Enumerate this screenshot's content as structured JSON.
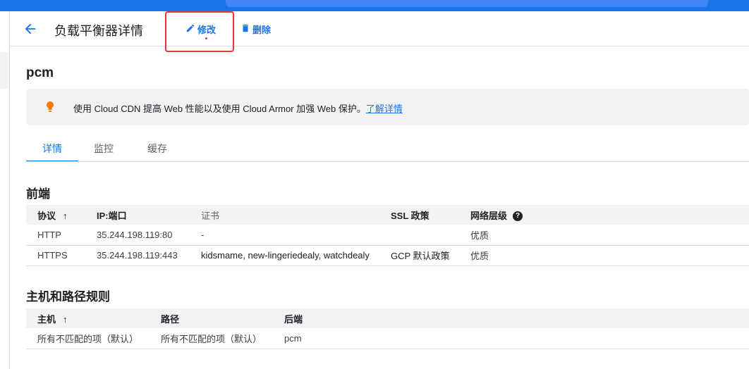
{
  "header": {
    "title": "负载平衡器详情",
    "edit_label": "修改",
    "delete_label": "删除"
  },
  "lb_name": "pcm",
  "banner": {
    "message": "使用 Cloud CDN 提高 Web 性能以及使用 Cloud Armor 加强 Web 保护。",
    "link": "了解详情"
  },
  "tabs": [
    {
      "label": "详情"
    },
    {
      "label": "监控"
    },
    {
      "label": "缓存"
    }
  ],
  "frontend": {
    "title": "前端",
    "headers": [
      "协议",
      "IP:端口",
      "证书",
      "SSL 政策",
      "网络层级"
    ],
    "rows": [
      [
        "HTTP",
        "35.244.198.119:80",
        "-",
        "",
        "优质"
      ],
      [
        "HTTPS",
        "35.244.198.119:443",
        "kidsmame, new-lingeriedealy, watchdealy",
        "GCP 默认政策",
        "优质"
      ]
    ]
  },
  "host_rules": {
    "title": "主机和路径规则",
    "headers": [
      "主机",
      "路径",
      "后端"
    ],
    "rows": [
      [
        "所有不匹配的项（默认）",
        "所有不匹配的项（默认）",
        "pcm"
      ]
    ]
  },
  "colors": {
    "accent": "#1a73e8",
    "highlight": "#e53935",
    "bulb": "#f57c00"
  },
  "icons": {
    "back": "arrow-back-icon",
    "edit": "pencil-icon",
    "delete": "trash-icon",
    "bulb": "lightbulb-icon",
    "help": "help-circle-icon",
    "sort": "arrow-up-icon"
  }
}
